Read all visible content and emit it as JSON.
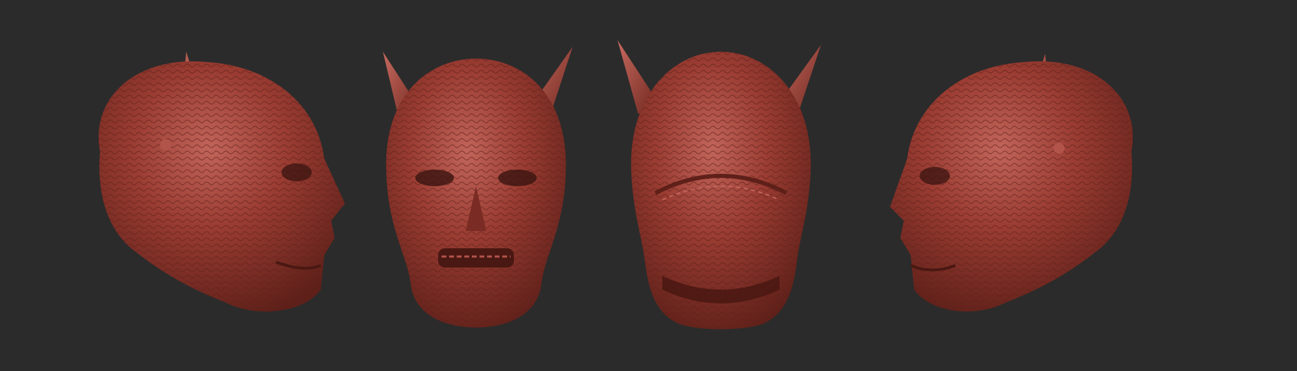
{
  "scene": {
    "background_color": "#2b2b2b",
    "material_color": "#9a3c32",
    "material_shadow_color": "#5e2019",
    "material_highlight_color": "#c1645a",
    "subject": "horned-demon-head-sculpt",
    "views": [
      {
        "view": "left-profile"
      },
      {
        "view": "front"
      },
      {
        "view": "back"
      },
      {
        "view": "right-profile"
      }
    ]
  }
}
